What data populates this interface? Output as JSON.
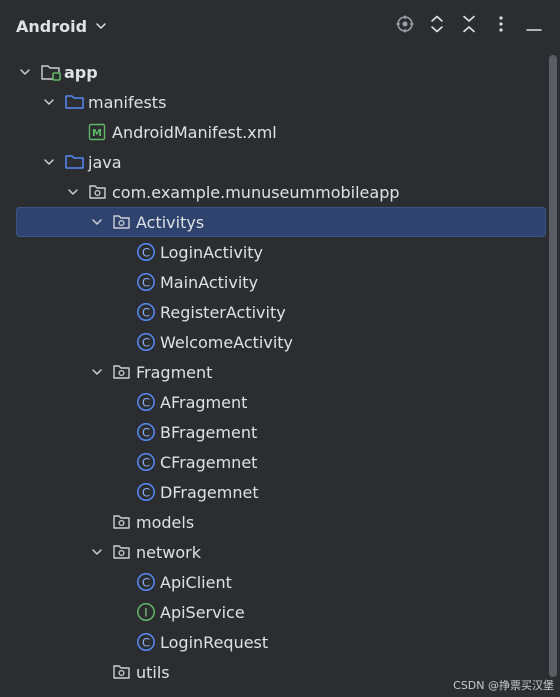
{
  "header": {
    "view_label": "Android"
  },
  "tree": [
    {
      "label": "app",
      "icon": "module-folder-icon",
      "arrow": "down",
      "bold": true
    },
    {
      "label": "manifests",
      "icon": "folder-icon",
      "arrow": "down"
    },
    {
      "label": "AndroidManifest.xml",
      "icon": "manifest-file-icon"
    },
    {
      "label": "java",
      "icon": "folder-icon",
      "arrow": "down"
    },
    {
      "label": "com.example.munuseummobileapp",
      "icon": "package-icon",
      "arrow": "down"
    },
    {
      "label": "Activitys",
      "icon": "package-icon",
      "arrow": "down",
      "selected": true
    },
    {
      "label": "LoginActivity",
      "icon": "class-icon"
    },
    {
      "label": "MainActivity",
      "icon": "class-icon"
    },
    {
      "label": "RegisterActivity",
      "icon": "class-icon"
    },
    {
      "label": "WelcomeActivity",
      "icon": "class-icon"
    },
    {
      "label": "Fragment",
      "icon": "package-icon",
      "arrow": "down"
    },
    {
      "label": "AFragment",
      "icon": "class-icon"
    },
    {
      "label": "BFragement",
      "icon": "class-icon"
    },
    {
      "label": "CFragemnet",
      "icon": "class-icon"
    },
    {
      "label": "DFragemnet",
      "icon": "class-icon"
    },
    {
      "label": "models",
      "icon": "package-icon"
    },
    {
      "label": "network",
      "icon": "package-icon",
      "arrow": "down"
    },
    {
      "label": "ApiClient",
      "icon": "class-icon"
    },
    {
      "label": "ApiService",
      "icon": "interface-icon"
    },
    {
      "label": "LoginRequest",
      "icon": "class-icon"
    },
    {
      "label": "utils",
      "icon": "package-icon"
    }
  ],
  "watermark": "CSDN @挣票买汉堡",
  "colors": {
    "background": "#2b2d30",
    "selection": "#2e436e",
    "folder_blue": "#548af7",
    "class_blue": "#548af7",
    "interface_green": "#5fb865",
    "text": "#dfe1e5"
  }
}
